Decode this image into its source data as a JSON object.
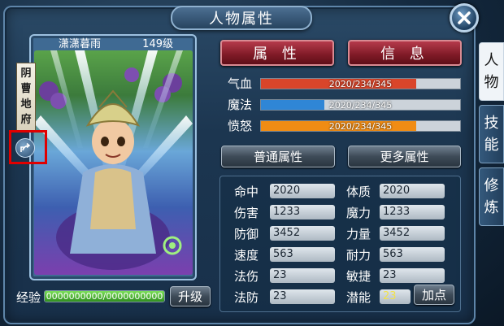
{
  "window": {
    "title": "人物属性"
  },
  "character": {
    "name": "潇潇暮雨",
    "level": "149级",
    "school": [
      "阴",
      "曹",
      "地",
      "府"
    ]
  },
  "tabs": {
    "attributes": "属 性",
    "info": "信 息"
  },
  "bars": [
    {
      "label": "气血",
      "text": "2020/234/345",
      "fraction": 0.78,
      "color": "#d9452a"
    },
    {
      "label": "魔法",
      "text": "2020/234/345",
      "fraction": 0.32,
      "color": "#2f86d6"
    },
    {
      "label": "愤怒",
      "text": "2020/234/345",
      "fraction": 0.78,
      "color": "#f08c14"
    }
  ],
  "subtabs": {
    "normal": "普通属性",
    "more": "更多属性"
  },
  "stats_left": [
    {
      "label": "命中",
      "value": "2020"
    },
    {
      "label": "伤害",
      "value": "1233"
    },
    {
      "label": "防御",
      "value": "3452"
    },
    {
      "label": "速度",
      "value": "563"
    },
    {
      "label": "法伤",
      "value": "23"
    },
    {
      "label": "法防",
      "value": "23"
    }
  ],
  "stats_right": [
    {
      "label": "体质",
      "value": "2020"
    },
    {
      "label": "魔力",
      "value": "1233"
    },
    {
      "label": "力量",
      "value": "3452"
    },
    {
      "label": "耐力",
      "value": "563"
    },
    {
      "label": "敏捷",
      "value": "23"
    },
    {
      "label": "潜能",
      "value": "23"
    }
  ],
  "add_points_button": "加点",
  "exp": {
    "label": "经验",
    "text": "0000000000/0000000000",
    "fraction": 1.0
  },
  "upgrade_button": "升级",
  "side_tabs": [
    {
      "chars": [
        "人",
        "物"
      ],
      "active": true
    },
    {
      "chars": [
        "技",
        "能"
      ],
      "active": false
    },
    {
      "chars": [
        "修",
        "炼"
      ],
      "active": false
    }
  ],
  "icons": {
    "close": "close-icon",
    "share": "share-icon"
  }
}
